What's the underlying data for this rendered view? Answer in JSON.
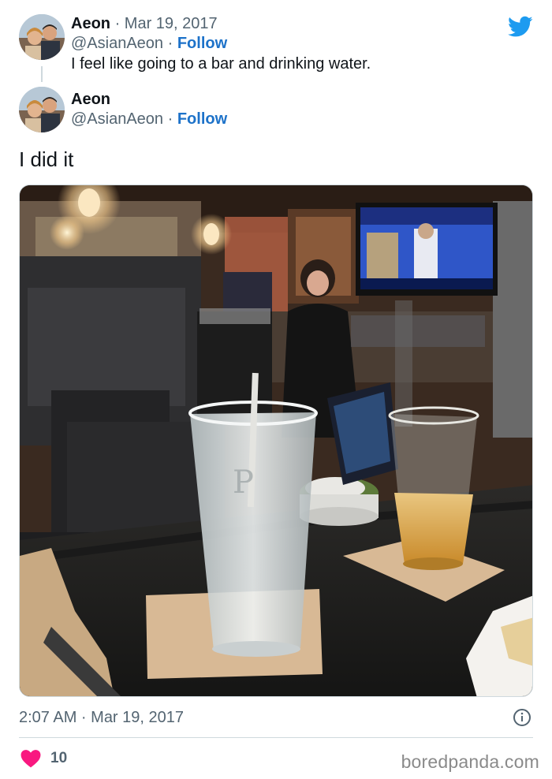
{
  "parent_tweet": {
    "name": "Aeon",
    "separator": "·",
    "date": "Mar 19, 2017",
    "handle": "@AsianAeon",
    "handle_separator": "·",
    "follow_label": "Follow",
    "text": "I feel like going to a bar and drinking water."
  },
  "reply_tweet": {
    "name": "Aeon",
    "handle": "@AsianAeon",
    "handle_separator": "·",
    "follow_label": "Follow",
    "text": "I did it",
    "timestamp": "2:07 AM · Mar 19, 2017",
    "likes": "10"
  },
  "watermark": "boredpanda.com",
  "icons": {
    "brand": "twitter-bird-icon",
    "info": "info-icon",
    "like": "heart-icon"
  },
  "colors": {
    "brand": "#1d9bf0",
    "follow": "#1d72c9",
    "heart": "#f91880",
    "secondary_text": "#536471"
  }
}
